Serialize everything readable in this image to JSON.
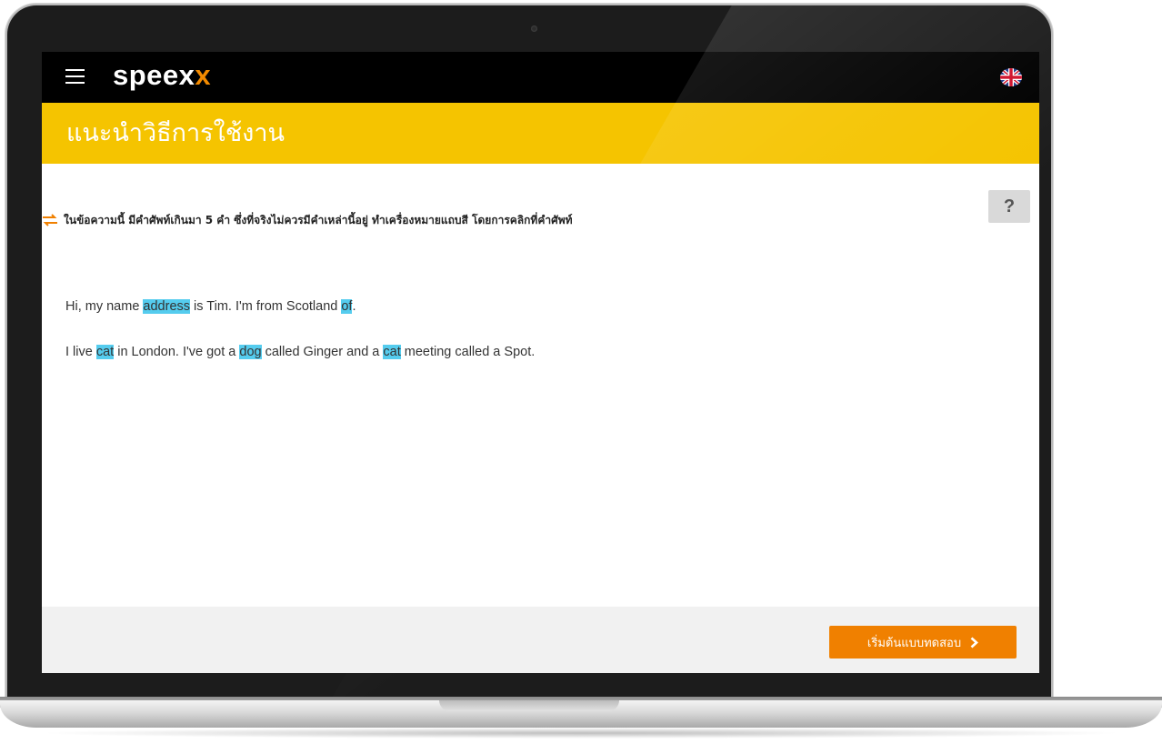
{
  "app": {
    "logo_main": "speex",
    "logo_accent": "x",
    "brand_colors": {
      "topbar": "#000000",
      "titlebar": "#f5c400",
      "accent": "#f08000",
      "highlight": "#55ccee"
    }
  },
  "header": {
    "menu_icon": "hamburger-menu-icon",
    "language_icon": "uk-flag-icon"
  },
  "page": {
    "title": "แนะนำวิธีการใช้งาน",
    "help_label": "?",
    "instruction": "ในข้อความนี้ มีคำศัพท์เกินมา 5 คำ ซึ่งที่จริงไม่ควรมีคำเหล่านี้อยู่ ทำเครื่องหมายแถบสี โดยการคลิกที่คำศัพท์"
  },
  "exercise": {
    "sentence1": {
      "p1": "Hi, my name ",
      "w1": "address",
      "p2": " is Tim. I'm from Scotland ",
      "w2": "of",
      "p3": "."
    },
    "sentence2": {
      "p1": "I live ",
      "w1": "cat",
      "p2": " in London. I've got a ",
      "w2": "dog",
      "p3": " called Ginger and a ",
      "w3": "cat",
      "p4": " meeting called a Spot."
    }
  },
  "footer": {
    "start_button_label": "เริ่มต้นแบบทดสอบ"
  }
}
